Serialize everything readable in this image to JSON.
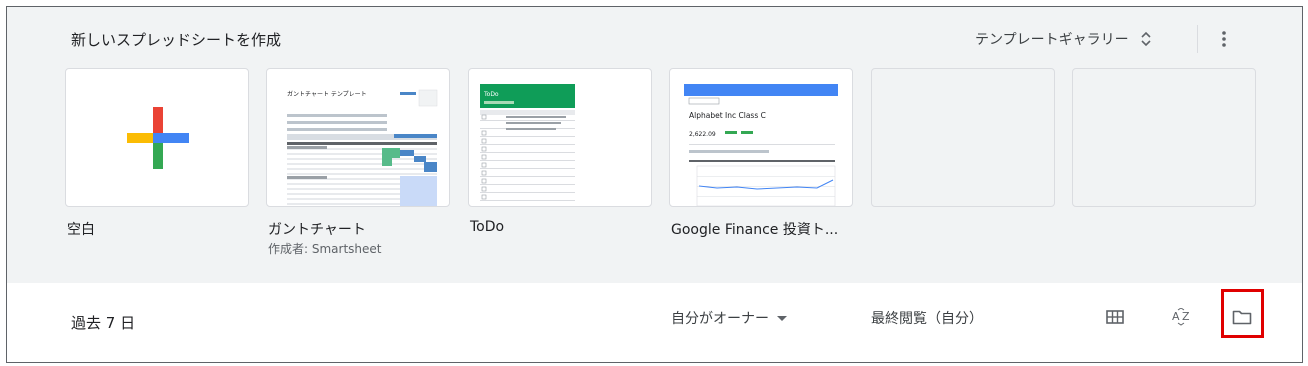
{
  "header": {
    "title": "新しいスプレッドシートを作成",
    "gallery_label": "テンプレートギャラリー"
  },
  "templates": [
    {
      "label": "空白",
      "sub": ""
    },
    {
      "label": "ガントチャート",
      "sub": "作成者: Smartsheet",
      "thumb_title": "ガントチャート テンプレート"
    },
    {
      "label": "ToDo",
      "sub": "",
      "thumb_title": "ToDo"
    },
    {
      "label": "Google Finance 投資ト...",
      "sub": "",
      "thumb_title": "Alphabet Inc Class C",
      "thumb_price": "2,622.09"
    }
  ],
  "bottom": {
    "period": "過去 7 日",
    "owner": "自分がオーナー",
    "last_viewed": "最終閲覧（自分）"
  },
  "colors": {
    "google_blue": "#4285f4",
    "google_red": "#ea4335",
    "google_yellow": "#fbbc04",
    "google_green": "#34a853",
    "sheets_green": "#0f9d58",
    "highlight": "#e00000"
  },
  "icons": {
    "gallery": "unfold-more-icon",
    "more": "more-vert-icon",
    "grid": "grid-view-icon",
    "sort": "sort-az-icon",
    "folder": "folder-icon"
  }
}
